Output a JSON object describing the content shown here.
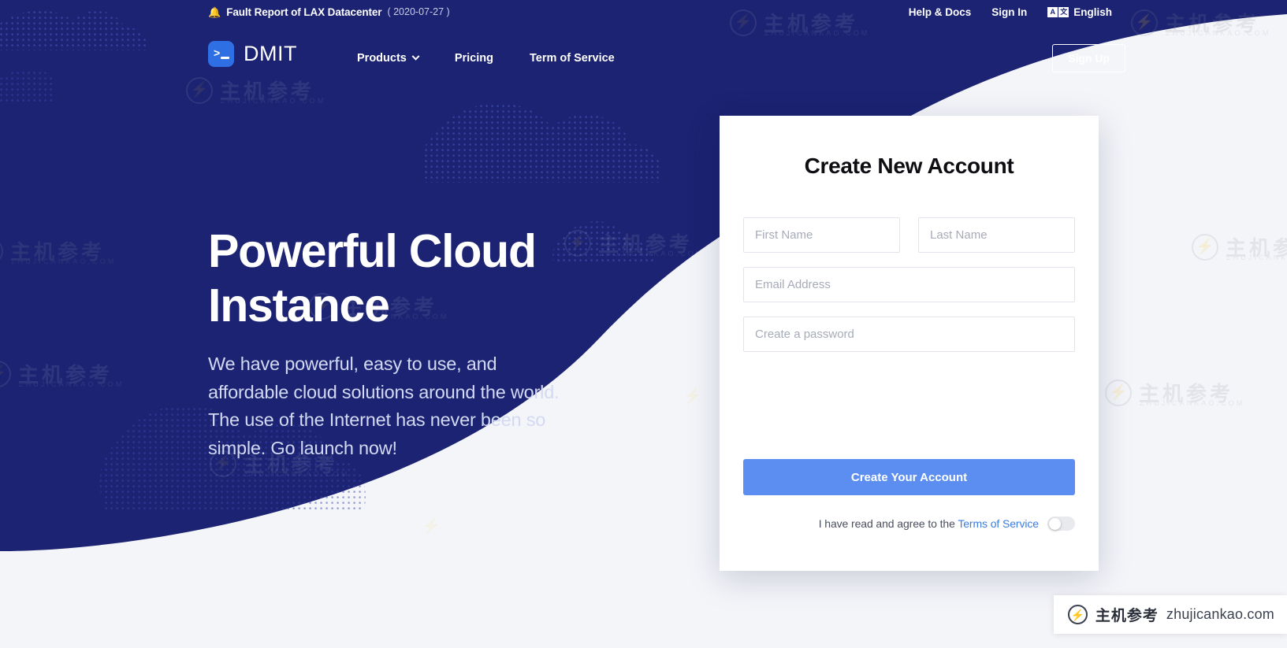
{
  "announce": {
    "bell_icon": "bell-icon",
    "title": "Fault Report of LAX Datacenter",
    "date": "( 2020-07-27 )",
    "help": "Help & Docs",
    "sign_in": "Sign In",
    "lang_icon_a": "A",
    "lang_icon_cjk": "文",
    "language": "English"
  },
  "nav": {
    "logo_glyph": ">",
    "brand": "DMIT",
    "links": [
      {
        "label": "Products",
        "has_caret": true
      },
      {
        "label": "Pricing",
        "has_caret": false
      },
      {
        "label": "Term of Service",
        "has_caret": false
      }
    ],
    "signup": "Sign Up"
  },
  "hero": {
    "heading": "Powerful Cloud Instance",
    "paragraph": "We have powerful, easy to use, and affordable cloud solutions around the world. The use of the Internet has never been so simple. Go launch now!"
  },
  "card": {
    "title": "Create New Account",
    "first_name_placeholder": "First Name",
    "last_name_placeholder": "Last Name",
    "email_placeholder": "Email Address",
    "password_placeholder": "Create a password",
    "first_name_value": "",
    "last_name_value": "",
    "email_value": "",
    "password_value": "",
    "submit": "Create Your Account",
    "terms_prefix": "I have read and agree to the ",
    "terms_link": "Terms of Service",
    "terms_toggle_state": "off"
  },
  "watermark": {
    "mark": "⚡",
    "cn": "主机参考",
    "en": "ZHUJICANKAO.COM"
  },
  "badge": {
    "mark": "⚡",
    "cn": "主机参考",
    "url": "zhujicankao.com"
  },
  "colors": {
    "navy": "#1b2372",
    "accent_blue": "#5b8ef0",
    "logo_blue": "#2f6fe4",
    "link_blue": "#3a7ce0",
    "page_bg": "#f4f5f9"
  }
}
